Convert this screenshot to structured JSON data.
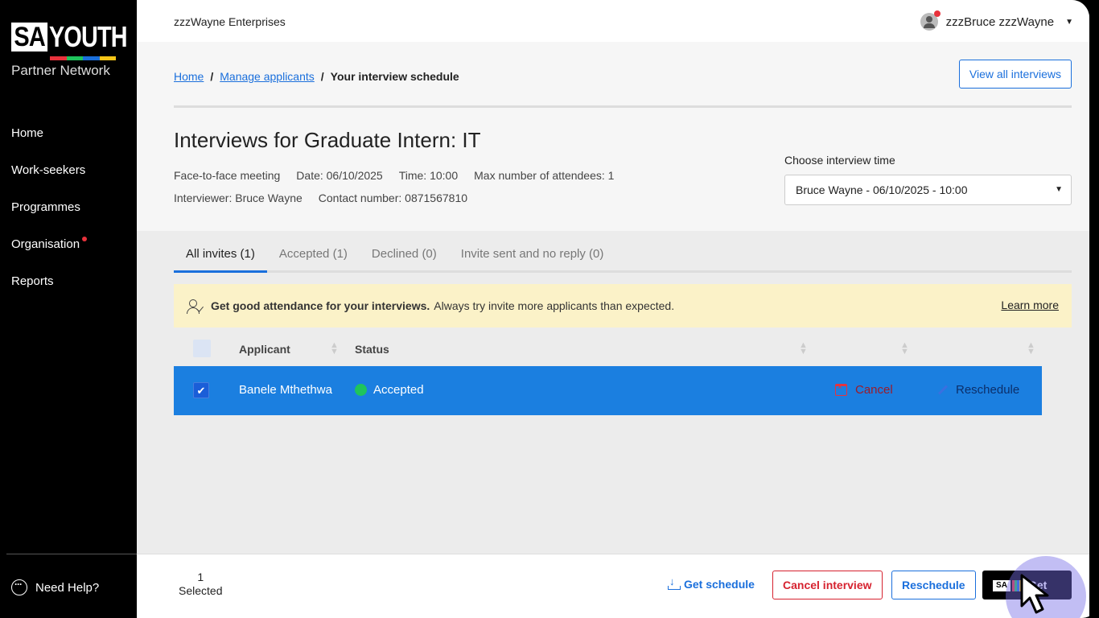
{
  "sidebar": {
    "logo_sa": "SA",
    "logo_youth": "YOUTH",
    "logo_sub": "Partner Network",
    "brand_colors": [
      "#e8323c",
      "#1fc45c",
      "#1a6fdc",
      "#f5c518"
    ],
    "items": [
      {
        "label": "Home"
      },
      {
        "label": "Work-seekers"
      },
      {
        "label": "Programmes"
      },
      {
        "label": "Organisation",
        "notification": true
      },
      {
        "label": "Reports"
      }
    ],
    "help_label": "Need Help?"
  },
  "topbar": {
    "company": "zzzWayne Enterprises",
    "user_name": "zzzBruce zzzWayne"
  },
  "breadcrumb": {
    "home": "Home",
    "sep": "/",
    "manage": "Manage applicants",
    "current": "Your interview schedule"
  },
  "header": {
    "view_all_label": "View all interviews",
    "title": "Interviews for Graduate Intern: IT",
    "meeting_type": "Face-to-face meeting",
    "date": "Date: 06/10/2025",
    "time": "Time: 10:00",
    "max_attendees": "Max number of attendees: 1",
    "interviewer": "Interviewer: Bruce Wayne",
    "contact": "Contact number: 0871567810",
    "choose_label": "Choose interview time",
    "selected_time": "Bruce Wayne - 06/10/2025 - 10:00"
  },
  "tabs": [
    {
      "label": "All invites (1)",
      "active": true
    },
    {
      "label": "Accepted (1)"
    },
    {
      "label": "Declined (0)"
    },
    {
      "label": "Invite sent and no reply (0)"
    }
  ],
  "banner": {
    "bold": "Get good attendance for your interviews.",
    "text": "Always try invite more applicants than expected.",
    "link": "Learn more"
  },
  "table": {
    "columns": [
      "Applicant",
      "Status"
    ],
    "rows": [
      {
        "applicant": "Banele Mthethwa",
        "status": "Accepted",
        "status_color": "#1fc45c",
        "selected": true,
        "cancel": "Cancel",
        "reschedule": "Reschedule"
      }
    ]
  },
  "footer": {
    "count": "1",
    "count_label": "Selected",
    "get_schedule": "Get schedule",
    "cancel_interview": "Cancel interview",
    "reschedule": "Reschedule",
    "get_cv_logo": "SA",
    "get_cv": "Get CV"
  },
  "colors": {
    "accent": "#1a6fdc",
    "selected_row": "#1b7fe0",
    "danger": "#d6222f",
    "banner": "#fbf2c8"
  }
}
